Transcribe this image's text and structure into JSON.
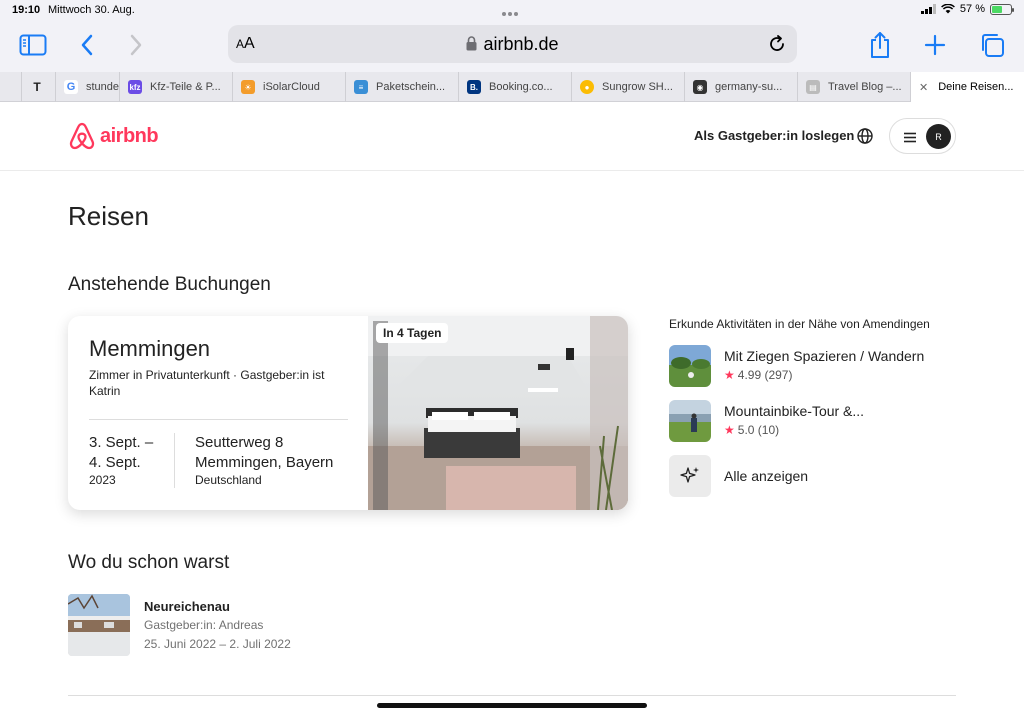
{
  "status": {
    "time": "19:10",
    "date": "Mittwoch 30. Aug.",
    "battery": "57 %",
    "battery_level": 0.57
  },
  "browser": {
    "aa_label": "AA",
    "url": "airbnb.de",
    "tabs": [
      {
        "label": "",
        "favicon": "tesla-icon",
        "color": "#222"
      },
      {
        "label": "stunde",
        "favicon": "google-icon",
        "color": "#fff"
      },
      {
        "label": "Kfz-Teile & P...",
        "favicon": "kfz-icon",
        "color": "#6b4ce6"
      },
      {
        "label": "iSolarCloud",
        "favicon": "isolar-icon",
        "color": "#f39c2b"
      },
      {
        "label": "Paketschein...",
        "favicon": "paket-icon",
        "color": "#3a8fd6"
      },
      {
        "label": "Booking.co...",
        "favicon": "booking-icon",
        "color": "#003580"
      },
      {
        "label": "Sungrow SH...",
        "favicon": "maps-pin-icon",
        "color": "#34a853"
      },
      {
        "label": "germany-su...",
        "favicon": "camera-icon",
        "color": "#333"
      },
      {
        "label": "Travel Blog –...",
        "favicon": "blog-icon",
        "color": "#bbb"
      },
      {
        "label": "Deine Reisen...",
        "favicon": "close-icon",
        "color": "#fff",
        "active": true
      }
    ]
  },
  "header": {
    "logo_text": "airbnb",
    "host_link": "Als Gastgeber:in loslegen",
    "avatar_initial": "R"
  },
  "page": {
    "title": "Reisen",
    "upcoming_heading": "Anstehende Buchungen",
    "past_heading": "Wo du schon warst"
  },
  "booking": {
    "city": "Memmingen",
    "subtitle": "Zimmer in Privatunterkunft · Gastgeber:in ist Katrin",
    "date_line1": "3. Sept. –",
    "date_line2": "4. Sept.",
    "year": "2023",
    "street": "Seutterweg 8",
    "city_state": "Memmingen, Bayern",
    "country": "Deutschland",
    "badge": "In 4 Tagen"
  },
  "activities": {
    "title": "Erkunde Aktivitäten in der Nähe von Amendingen",
    "items": [
      {
        "name": "Mit Ziegen Spazieren / Wandern",
        "rating": "4.99 (297)"
      },
      {
        "name": "Mountainbike-Tour &...",
        "rating": "5.0 (10)"
      }
    ],
    "show_all": "Alle anzeigen"
  },
  "past_trip": {
    "name": "Neureichenau",
    "host": "Gastgeber:in: Andreas",
    "range": "25. Juni 2022 – 2. Juli 2022"
  },
  "colors": {
    "brand": "#ff385c",
    "safari_blue": "#1a7cf5"
  }
}
